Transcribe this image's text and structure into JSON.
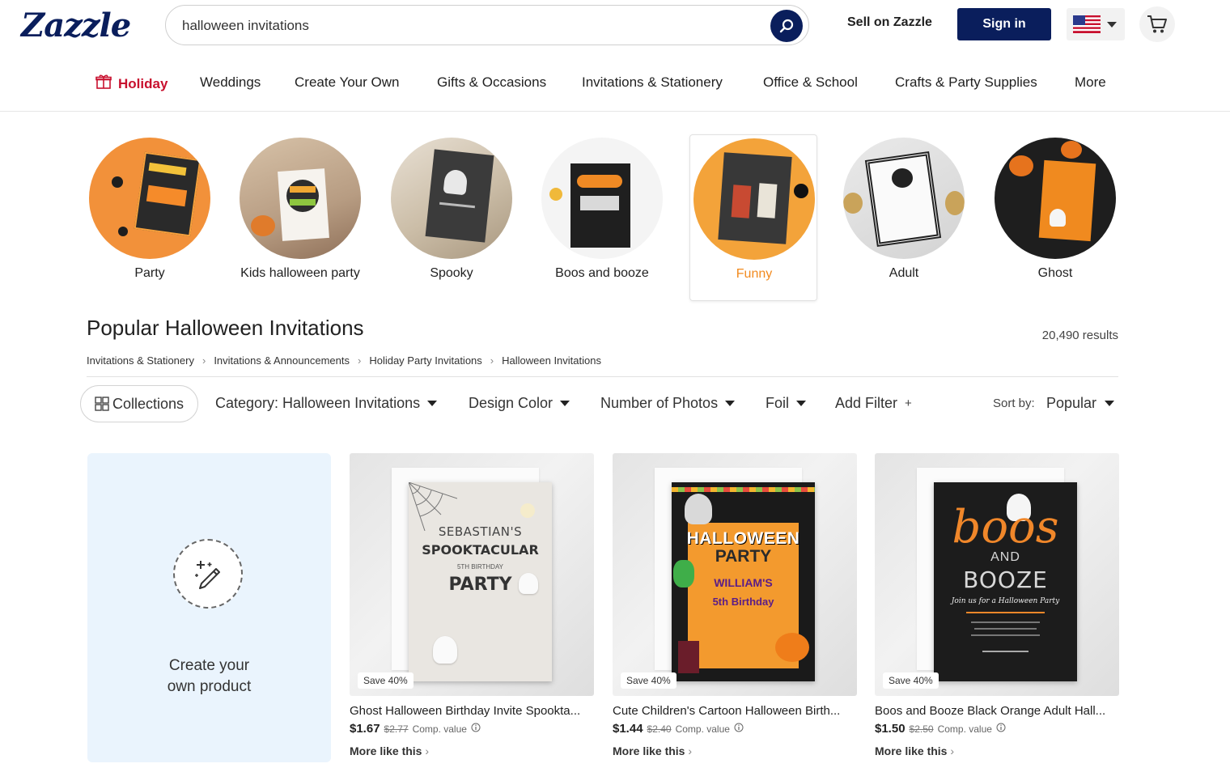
{
  "header": {
    "logo": "Zazzle",
    "search_value": "halloween invitations",
    "sell_label": "Sell on Zazzle",
    "signin_label": "Sign in"
  },
  "nav": {
    "items": [
      "Holiday",
      "Weddings",
      "Create Your Own",
      "Gifts & Occasions",
      "Invitations & Stationery",
      "Office & School",
      "Crafts & Party Supplies",
      "More"
    ]
  },
  "categories": {
    "items": [
      "Party",
      "Kids halloween party",
      "Spooky",
      "Boos and booze",
      "Funny",
      "Adult",
      "Ghost"
    ],
    "selected": "Funny"
  },
  "main": {
    "title": "Popular Halloween Invitations",
    "results": "20,490 results",
    "breadcrumbs": [
      "Invitations & Stationery",
      "Invitations & Announcements",
      "Holiday Party Invitations",
      "Halloween Invitations"
    ]
  },
  "filters": {
    "collections": "Collections",
    "category": "Category: Halloween Invitations",
    "design_color": "Design Color",
    "photos": "Number of Photos",
    "foil": "Foil",
    "add_filter": "Add Filter",
    "add_plus": "+",
    "sort_label": "Sort by:",
    "sort_value": "Popular"
  },
  "create_card": {
    "label": "Create your own product"
  },
  "products": [
    {
      "title": "Ghost Halloween Birthday Invite Spookta...",
      "price": "$1.67",
      "old_price": "$2.77",
      "comp": "Comp. value",
      "badge": "Save 40%",
      "more": "More like this",
      "card_text": [
        "SEBASTIAN'S",
        "SPOOKTACULAR",
        "5TH BIRTHDAY",
        "PARTY"
      ]
    },
    {
      "title": "Cute Children's Cartoon Halloween Birth...",
      "price": "$1.44",
      "old_price": "$2.40",
      "comp": "Comp. value",
      "badge": "Save 40%",
      "more": "More like this",
      "card_text": [
        "HALLOWEEN",
        "PARTY",
        "WILLIAM'S",
        "5th Birthday"
      ]
    },
    {
      "title": "Boos and Booze Black Orange Adult Hall...",
      "price": "$1.50",
      "old_price": "$2.50",
      "comp": "Comp. value",
      "badge": "Save 40%",
      "more": "More like this",
      "card_text": [
        "boos",
        "AND",
        "BOOZE",
        "Join us for a Halloween Party"
      ]
    }
  ],
  "colors": {
    "brand": "#0a1e5c",
    "holiday": "#c8102e",
    "selected": "#f28a1e",
    "create_bg": "#eaf4fd"
  },
  "icons": [
    "search-icon",
    "us-flag-icon",
    "cart-icon",
    "gift-icon",
    "grid-icon",
    "magic-pen-icon",
    "info-icon",
    "chevron-right-icon"
  ]
}
